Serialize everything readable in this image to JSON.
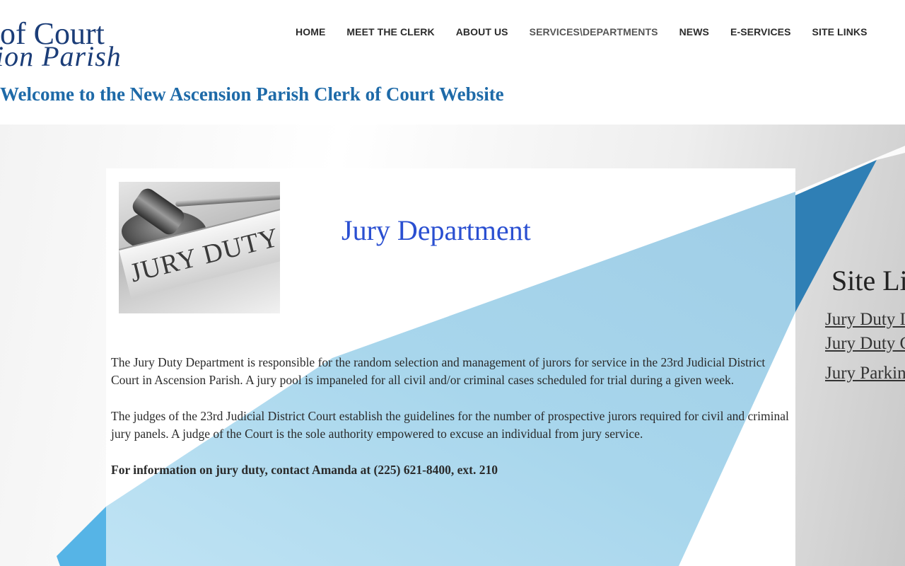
{
  "logo": {
    "line1": "of Court",
    "line2": "ion Parish"
  },
  "nav": {
    "items": [
      {
        "label": "HOME"
      },
      {
        "label": "MEET THE CLERK"
      },
      {
        "label": "ABOUT US"
      },
      {
        "label": "SERVICES\\DEPARTMENTS",
        "active": true
      },
      {
        "label": "NEWS"
      },
      {
        "label": "E-SERVICES"
      },
      {
        "label": "SITE LINKS"
      }
    ]
  },
  "welcome": "Welcome to the New Ascension Parish Clerk of Court Website",
  "department": {
    "image_text": "JURY DUTY",
    "title": "Jury Department",
    "paragraphs": [
      "The Jury Duty Department is responsible for the random selection and management of jurors for service in the 23rd Judicial District Court in Ascension Parish. A jury pool is impaneled for all civil and/or criminal cases scheduled for trial during a given week.",
      "The judges of the 23rd Judicial District Court establish the guidelines for the number of prospective jurors required for civil and criminal jury panels. A judge of the Court is the sole authority empowered to excuse an individual from jury service."
    ],
    "contact": "For information on jury duty, contact Amanda at (225) 621-8400, ext. 210"
  },
  "sidebar": {
    "title": "Site Li",
    "links": [
      {
        "label": "Jury Duty I"
      },
      {
        "label": "Jury Duty C"
      },
      {
        "label": "Jury Parkin"
      }
    ]
  },
  "colors": {
    "welcome": "#1e6aa8",
    "title": "#2a4fd1",
    "accent_blue": "#2f7fb5",
    "light_blue": "#a9d8ef"
  }
}
